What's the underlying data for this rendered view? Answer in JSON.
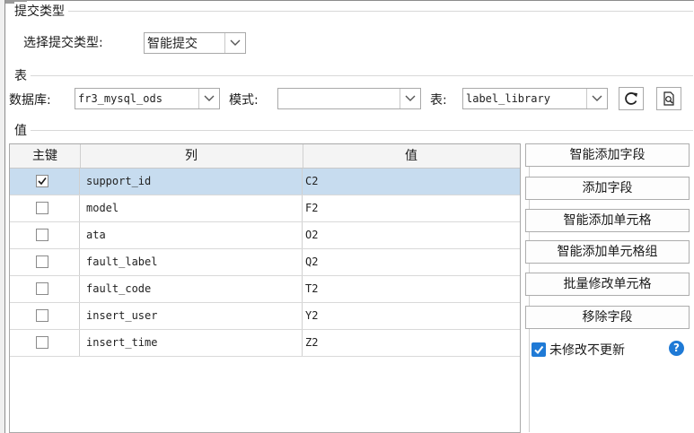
{
  "submit_type": {
    "section_title": "提交类型",
    "label": "选择提交类型:",
    "selected": "智能提交"
  },
  "table_section": {
    "section_title": "表",
    "db_label": "数据库:",
    "db_value": "fr3_mysql_ods",
    "mode_label": "模式:",
    "mode_value": "",
    "table_label": "表:",
    "table_value": "label_library",
    "refresh_icon": "refresh-icon",
    "preview_icon": "preview-search-icon"
  },
  "values_section": {
    "section_title": "值",
    "headers": {
      "key": "主键",
      "column": "列",
      "value": "值"
    },
    "rows": [
      {
        "key": true,
        "column": "support_id",
        "value": "C2"
      },
      {
        "key": false,
        "column": "model",
        "value": "F2"
      },
      {
        "key": false,
        "column": "ata",
        "value": "O2"
      },
      {
        "key": false,
        "column": "fault_label",
        "value": "Q2"
      },
      {
        "key": false,
        "column": "fault_code",
        "value": "T2"
      },
      {
        "key": false,
        "column": "insert_user",
        "value": "Y2"
      },
      {
        "key": false,
        "column": "insert_time",
        "value": "Z2"
      }
    ]
  },
  "buttons": {
    "smart_add_field": "智能添加字段",
    "add_field": "添加字段",
    "smart_add_cell": "智能添加单元格",
    "smart_add_cell_group": "智能添加单元格组",
    "batch_edit_cells": "批量修改单元格",
    "remove_field": "移除字段"
  },
  "no_update_unmodified": {
    "checked": true,
    "label": "未修改不更新"
  },
  "help_icon": "help-icon",
  "colors": {
    "accent": "#1f7ad6",
    "selected_row": "#c7dcef"
  }
}
